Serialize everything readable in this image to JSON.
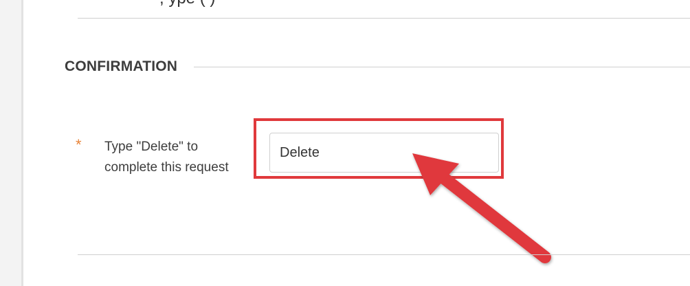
{
  "page": {
    "top_text": ", ype                                  (                )"
  },
  "section": {
    "title": "CONFIRMATION"
  },
  "form": {
    "required_marker": "*",
    "field_label": "Type \"Delete\" to complete this request",
    "field_value": "Delete"
  },
  "annotation": {
    "highlight_color": "#e0393c",
    "arrow_color": "#e0393c",
    "arrow_icon": "arrow-annotation-icon"
  }
}
